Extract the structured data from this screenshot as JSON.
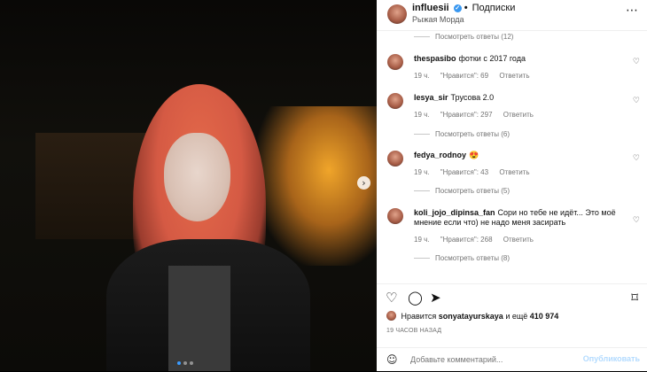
{
  "header": {
    "username": "influesii",
    "separator": "•",
    "follow_label": "Подписки",
    "subtitle": "Рыжая Морда",
    "more_icon": "⋯"
  },
  "photo": {
    "next_arrow": "›"
  },
  "comments": {
    "top_replies": "Посмотреть ответы (12)",
    "items": [
      {
        "username": "thespasibo",
        "text": "фотки с 2017 года",
        "time": "19 ч.",
        "likes": "\"Нравится\": 69",
        "reply": "Ответить",
        "replies": ""
      },
      {
        "username": "lesya_sir",
        "text": "Трусова 2.0",
        "time": "19 ч.",
        "likes": "\"Нравится\": 297",
        "reply": "Ответить",
        "replies": "Посмотреть ответы (6)"
      },
      {
        "username": "fedya_rodnoy",
        "text": "😍",
        "time": "19 ч.",
        "likes": "\"Нравится\": 43",
        "reply": "Ответить",
        "replies": "Посмотреть ответы (5)"
      },
      {
        "username": "koli_jojo_dipinsa_fan",
        "text": "Сори но тебе не идёт... Это моё мнение если что) не надо меня засирать",
        "time": "19 ч.",
        "likes": "\"Нравится\": 268",
        "reply": "Ответить",
        "replies": "Посмотреть ответы (8)"
      }
    ]
  },
  "actions": {
    "like_icon": "♡",
    "comment_icon": "◯",
    "share_icon": "➤",
    "save_icon": "⌑"
  },
  "likes": {
    "prefix": "Нравится",
    "user": "sonyatayurskaya",
    "middle": "и ещё",
    "count": "410 974"
  },
  "timestamp": "19 ЧАСОВ НАЗАД",
  "add_comment": {
    "emoji_icon": "☺",
    "placeholder": "Добавьте комментарий...",
    "publish_label": "Опубликовать"
  },
  "colors": {
    "accent": "#3897f0",
    "publish_disabled": "#b3dbff"
  }
}
